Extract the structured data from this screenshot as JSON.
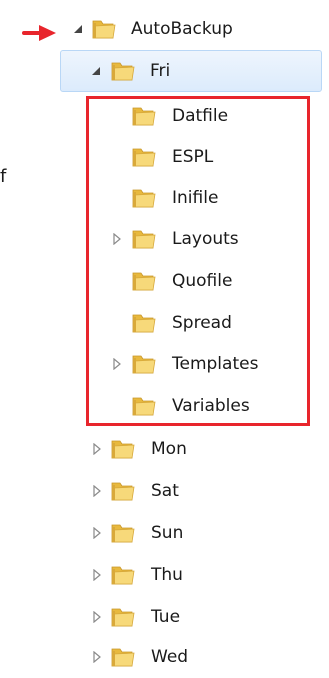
{
  "side_text": "f",
  "tree": {
    "root": {
      "label": "AutoBackup",
      "expanded": true,
      "icon": "folder-icon",
      "pointer_icon": "red-arrow-icon"
    },
    "selected": {
      "label": "Fri",
      "expanded": true,
      "icon": "folder-icon"
    },
    "fri_children": [
      {
        "label": "Datfile",
        "expandable": false
      },
      {
        "label": "ESPL",
        "expandable": false
      },
      {
        "label": "Inifile",
        "expandable": false
      },
      {
        "label": "Layouts",
        "expandable": true
      },
      {
        "label": "Quofile",
        "expandable": false
      },
      {
        "label": "Spread",
        "expandable": false
      },
      {
        "label": "Templates",
        "expandable": true
      },
      {
        "label": "Variables",
        "expandable": false
      }
    ],
    "siblings": [
      {
        "label": "Mon",
        "expandable": true
      },
      {
        "label": "Sat",
        "expandable": true
      },
      {
        "label": "Sun",
        "expandable": true
      },
      {
        "label": "Thu",
        "expandable": true
      },
      {
        "label": "Tue",
        "expandable": true
      },
      {
        "label": "Wed",
        "expandable": true
      }
    ]
  },
  "colors": {
    "highlight_border": "#e8252c",
    "selection_fill": "#dcebfc",
    "folder_yellow": "#f5d36b"
  }
}
